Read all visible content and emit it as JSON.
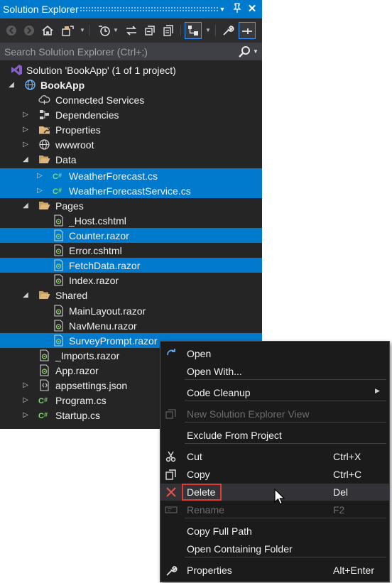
{
  "window": {
    "title": "Solution Explorer",
    "title_buttons": [
      "dropdown",
      "pin",
      "close"
    ]
  },
  "toolbar": {
    "icons": [
      "back-icon",
      "forward-icon",
      "home-icon",
      "switch-views-icon",
      "pending-changes-icon",
      "sync-icon",
      "collapse-all-icon",
      "show-all-files-icon",
      "preview-selected-icon",
      "properties-icon",
      "pin-preview-icon"
    ]
  },
  "search": {
    "placeholder": "Search Solution Explorer (Ctrl+;)"
  },
  "tree": {
    "solution": "Solution 'BookApp' (1 of 1 project)",
    "project": "BookApp",
    "items": [
      {
        "label": "Connected Services",
        "icon": "connected-services-icon",
        "selected": false
      },
      {
        "label": "Dependencies",
        "icon": "dependencies-icon",
        "selected": false
      },
      {
        "label": "Properties",
        "icon": "properties-folder-icon",
        "selected": false
      },
      {
        "label": "wwwroot",
        "icon": "globe-icon",
        "selected": false
      },
      {
        "label": "Data",
        "icon": "folder-open-icon",
        "selected": false
      },
      {
        "label": "WeatherForecast.cs",
        "icon": "csharp-file-icon",
        "selected": true
      },
      {
        "label": "WeatherForecastService.cs",
        "icon": "csharp-file-icon",
        "selected": true
      },
      {
        "label": "Pages",
        "icon": "folder-open-icon",
        "selected": false
      },
      {
        "label": "_Host.cshtml",
        "icon": "razor-file-icon",
        "selected": false
      },
      {
        "label": "Counter.razor",
        "icon": "razor-file-icon",
        "selected": true
      },
      {
        "label": "Error.cshtml",
        "icon": "razor-file-icon",
        "selected": false
      },
      {
        "label": "FetchData.razor",
        "icon": "razor-file-icon",
        "selected": true
      },
      {
        "label": "Index.razor",
        "icon": "razor-file-icon",
        "selected": false
      },
      {
        "label": "Shared",
        "icon": "folder-open-icon",
        "selected": false
      },
      {
        "label": "MainLayout.razor",
        "icon": "razor-file-icon",
        "selected": false
      },
      {
        "label": "NavMenu.razor",
        "icon": "razor-file-icon",
        "selected": false
      },
      {
        "label": "SurveyPrompt.razor",
        "icon": "razor-file-icon",
        "selected": true
      },
      {
        "label": "_Imports.razor",
        "icon": "razor-file-icon",
        "selected": false
      },
      {
        "label": "App.razor",
        "icon": "razor-file-icon",
        "selected": false
      },
      {
        "label": "appsettings.json",
        "icon": "json-file-icon",
        "selected": false
      },
      {
        "label": "Program.cs",
        "icon": "csharp-file-icon",
        "selected": false
      },
      {
        "label": "Startup.cs",
        "icon": "csharp-file-icon",
        "selected": false
      }
    ]
  },
  "context_menu": {
    "items": [
      {
        "label": "Open",
        "shortcut": "",
        "icon": "open-icon",
        "enabled": true
      },
      {
        "label": "Open With...",
        "shortcut": "",
        "icon": "",
        "enabled": true
      },
      {
        "label": "Code Cleanup",
        "shortcut": "",
        "icon": "",
        "enabled": true,
        "submenu": true
      },
      {
        "label": "New Solution Explorer View",
        "shortcut": "",
        "icon": "new-view-icon",
        "enabled": false
      },
      {
        "label": "Exclude From Project",
        "shortcut": "",
        "icon": "",
        "enabled": true
      },
      {
        "label": "Cut",
        "shortcut": "Ctrl+X",
        "icon": "cut-icon",
        "enabled": true
      },
      {
        "label": "Copy",
        "shortcut": "Ctrl+C",
        "icon": "copy-icon",
        "enabled": true
      },
      {
        "label": "Delete",
        "shortcut": "Del",
        "icon": "delete-icon",
        "enabled": true,
        "highlighted": true
      },
      {
        "label": "Rename",
        "shortcut": "F2",
        "icon": "rename-icon",
        "enabled": false
      },
      {
        "label": "Copy Full Path",
        "shortcut": "",
        "icon": "",
        "enabled": true
      },
      {
        "label": "Open Containing Folder",
        "shortcut": "",
        "icon": "",
        "enabled": true
      },
      {
        "label": "Properties",
        "shortcut": "Alt+Enter",
        "icon": "wrench-icon",
        "enabled": true
      }
    ]
  },
  "colors": {
    "accent": "#007acc",
    "panel_bg": "#252526",
    "menu_bg": "#1b1b1c",
    "delete_outline": "#e23b35",
    "delete_icon": "#e8534d"
  }
}
